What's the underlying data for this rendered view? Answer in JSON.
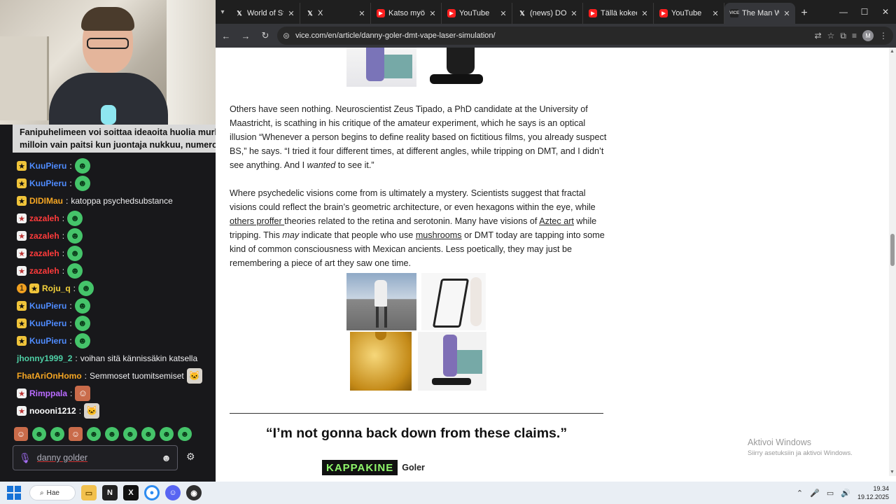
{
  "pinned_message": {
    "line1": "Fanipuhelimeen voi soittaa ideaoita huolia murhe",
    "line2": "milloin vain paitsi kun juontaja nukkuu, numeron"
  },
  "chat": {
    "messages": [
      {
        "user": "KuuPieru",
        "color": "#4f8cff",
        "badges": [
          "gold"
        ],
        "text": "",
        "emote": "frog"
      },
      {
        "user": "KuuPieru",
        "color": "#4f8cff",
        "badges": [
          "gold"
        ],
        "text": "",
        "emote": "frog"
      },
      {
        "user": "DIDIMau",
        "color": "#f5a623",
        "badges": [
          "gold"
        ],
        "text": "katoppa psychedsubstance",
        "emote": ""
      },
      {
        "user": "zazaleh",
        "color": "#ff3b3b",
        "badges": [
          "red"
        ],
        "text": "",
        "emote": "frog"
      },
      {
        "user": "zazaleh",
        "color": "#ff3b3b",
        "badges": [
          "red"
        ],
        "text": "",
        "emote": "frog"
      },
      {
        "user": "zazaleh",
        "color": "#ff3b3b",
        "badges": [
          "red"
        ],
        "text": "",
        "emote": "frog"
      },
      {
        "user": "zazaleh",
        "color": "#ff3b3b",
        "badges": [
          "red"
        ],
        "text": "",
        "emote": "frog"
      },
      {
        "user": "Roju_q",
        "color": "#f3d13b",
        "badges": [
          "orange",
          "gold"
        ],
        "text": "",
        "emote": "frog"
      },
      {
        "user": "KuuPieru",
        "color": "#4f8cff",
        "badges": [
          "gold"
        ],
        "text": "",
        "emote": "frog"
      },
      {
        "user": "KuuPieru",
        "color": "#4f8cff",
        "badges": [
          "gold"
        ],
        "text": "",
        "emote": "frog"
      },
      {
        "user": "KuuPieru",
        "color": "#4f8cff",
        "badges": [
          "gold"
        ],
        "text": "",
        "emote": "frog"
      },
      {
        "user": "jhonny1999_2",
        "color": "#4ed0a6",
        "badges": [],
        "text": "voihan sitä kännissäkin katsella",
        "emote": ""
      },
      {
        "user": "FhatAriOnHomo",
        "color": "#f5a623",
        "badges": [],
        "text": "Semmoset tuomitsemiset",
        "emote": "cat"
      },
      {
        "user": "Rimppala",
        "color": "#b96bff",
        "badges": [
          "red"
        ],
        "text": "",
        "emote": "face"
      },
      {
        "user": "noooni1212",
        "color": "#ffffff",
        "badges": [
          "red"
        ],
        "text": "",
        "emote": "cat"
      }
    ],
    "input_value": "danny golder"
  },
  "browser": {
    "tabs": [
      {
        "title": "World of Statist",
        "icon": "x-icon"
      },
      {
        "title": "X",
        "icon": "x-icon"
      },
      {
        "title": "Katso myöhem",
        "icon": "youtube-icon"
      },
      {
        "title": "YouTube",
        "icon": "youtube-icon"
      },
      {
        "title": "(news) DOGE X",
        "icon": "x-icon"
      },
      {
        "title": "Tällä kokeella v",
        "icon": "youtube-icon"
      },
      {
        "title": "YouTube",
        "icon": "youtube-icon"
      },
      {
        "title": "The Man Who",
        "icon": "vice-icon",
        "active": true
      }
    ],
    "url": "vice.com/en/article/danny-goler-dmt-vape-laser-simulation/",
    "profile_initial": "M"
  },
  "article": {
    "para1_a": "Others have seen nothing. Neuroscientist Zeus Tipado, a PhD candidate at the University of Maastricht, is scathing in his critique of the amateur experiment, which he says is an optical illusion “Whenever a person begins to define reality based on fictitious films, you already suspect BS,” he says. “I tried it four different times, at different angles, while tripping on DMT, and I didn’t see anything. And I ",
    "para1_em": "wanted",
    "para1_b": " to see it.”",
    "para2_a": "Where psychedelic visions come from is ultimately a mystery. Scientists suggest that fractal visions could reflect the brain’s geometric architecture, or even hexagons within the eye, while ",
    "para2_link1": "others proffer ",
    "para2_b": "theories related to the retina and serotonin. Many have visions of ",
    "para2_link2": "Aztec art",
    "para2_c": " while tripping. This ",
    "para2_em": "may",
    "para2_d": " indicate that people who use ",
    "para2_link3": "mushrooms",
    "para2_e": " or DMT today are tapping into some kind of common consciousness with Mexican ancients. Less poetically, they may just be remembering a piece of art they saw one time.",
    "pull_quote": "“I’m not gonna back down from these claims.”",
    "byline_overlay": "KAPPAKINE",
    "byline_fragment": "Goler"
  },
  "watermark": {
    "line1": "Aktivoi Windows",
    "line2": "Siirry asetuksiin ja aktivoi Windows."
  },
  "taskbar": {
    "search_label": "Hae",
    "time": "19.34",
    "date": "19.12.2025"
  }
}
